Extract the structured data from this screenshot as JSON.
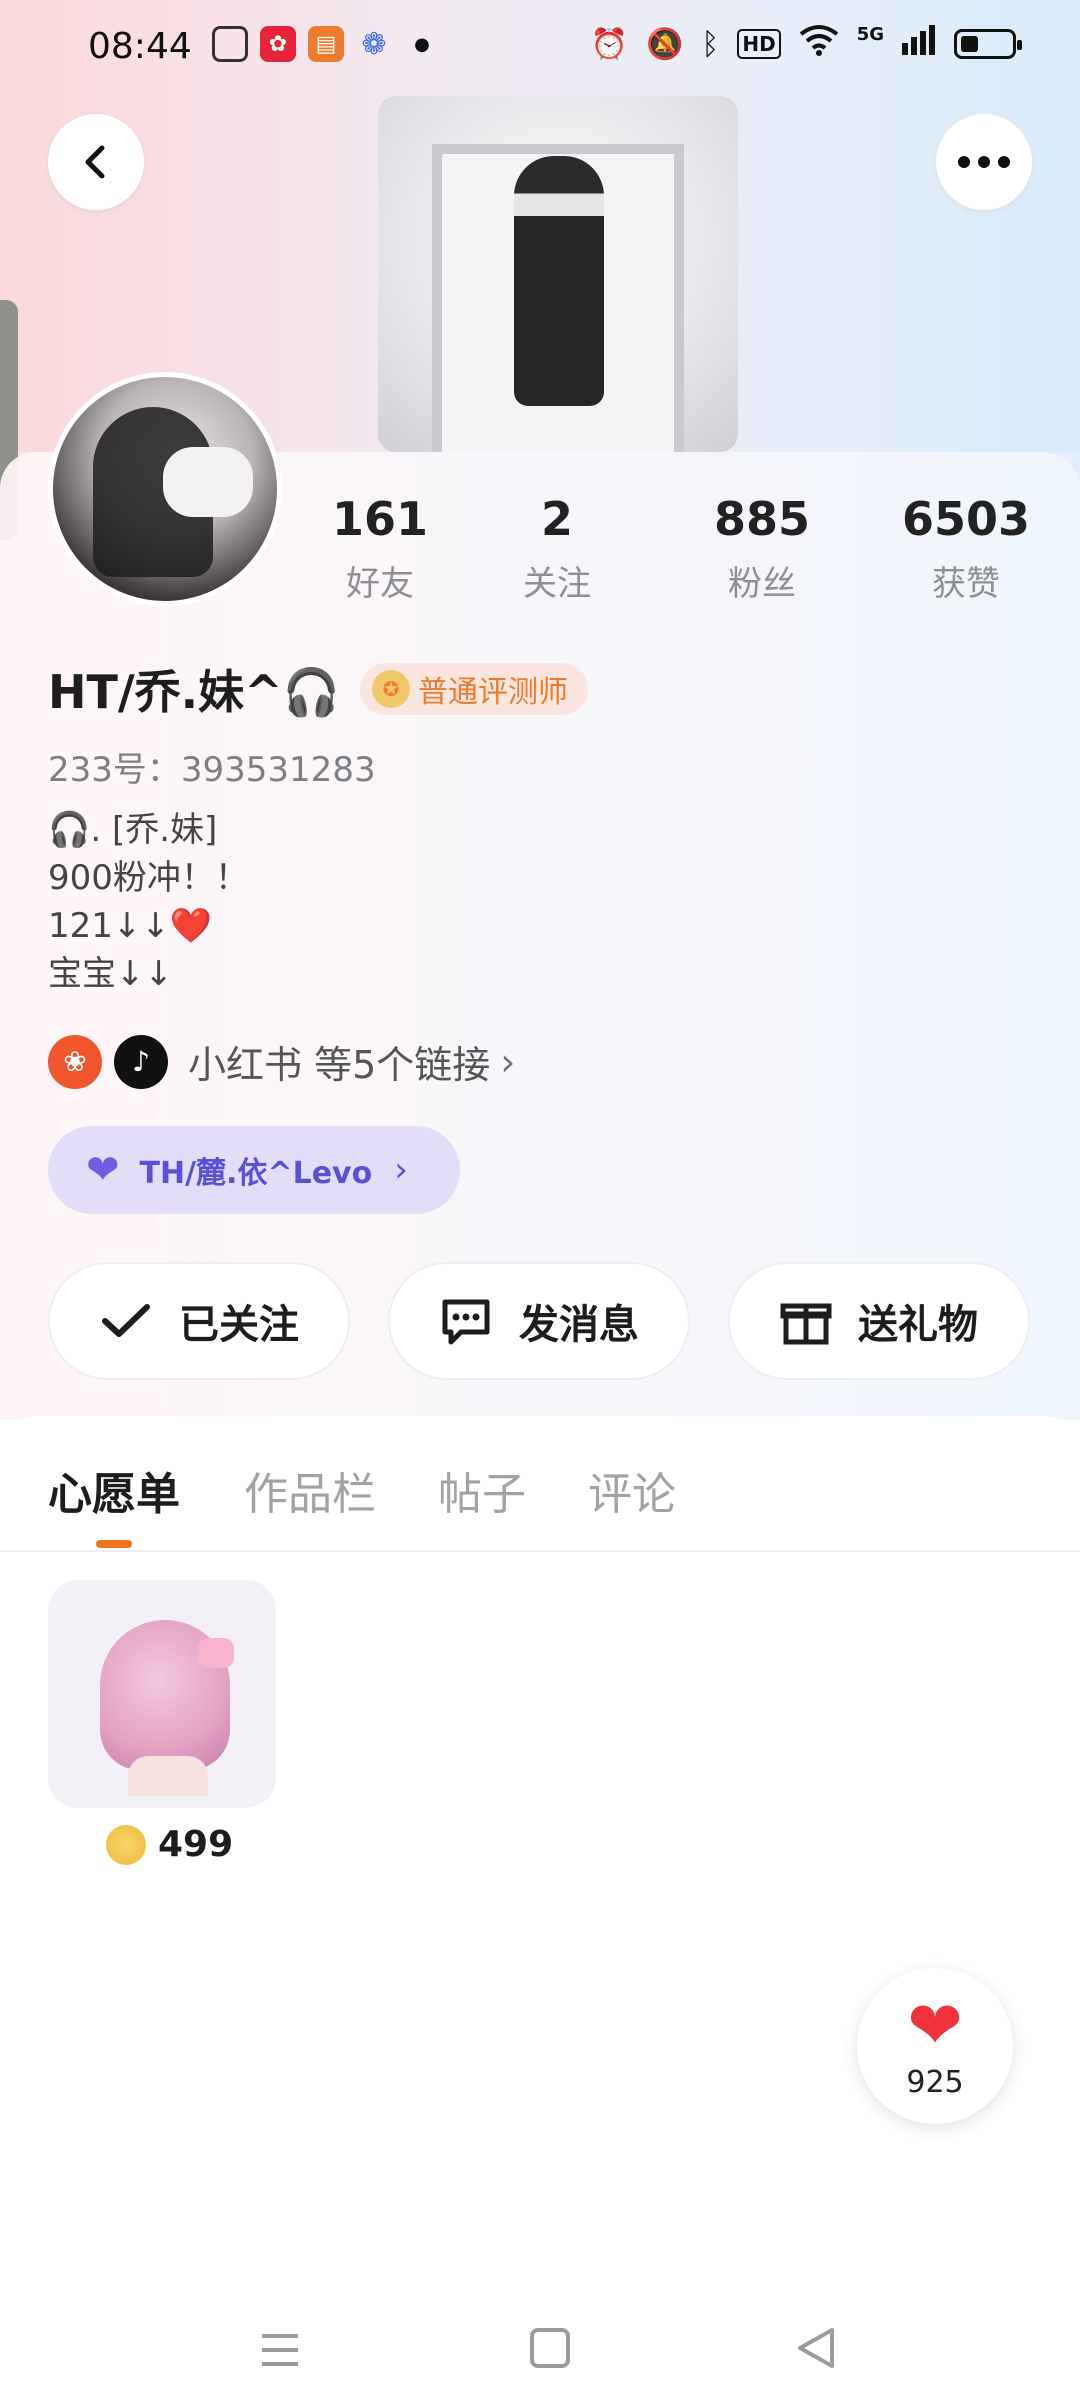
{
  "status_bar": {
    "time": "08:44",
    "network": "5G",
    "battery_level": 0.35,
    "icons": [
      "app-folder-icon",
      "app-red-icon",
      "app-book-icon",
      "app-paw-icon",
      "dot-icon",
      "alarm-icon",
      "mute-icon",
      "bluetooth-icon",
      "hd-icon",
      "wifi-icon",
      "signal-icon",
      "battery-icon"
    ]
  },
  "header": {
    "back_icon": "back-icon",
    "more_icon": "more-icon"
  },
  "profile": {
    "name": "HT/乔.妹^🎧",
    "badge_label": "普通评测师",
    "uid": "233号：393531283",
    "bio": [
      "🎧. [乔.妹]",
      "900粉冲！！",
      "121↓↓❤️",
      "宝宝↓↓"
    ]
  },
  "stats": [
    {
      "num": "161",
      "label": "好友"
    },
    {
      "num": "2",
      "label": "关注"
    },
    {
      "num": "885",
      "label": "粉丝"
    },
    {
      "num": "6503",
      "label": "获赞"
    }
  ],
  "links": {
    "text": "小红书 等5个链接",
    "chevron": "›"
  },
  "cp_pill": {
    "label": "TH/麓.依^Levo",
    "arrow": "›",
    "color": "#5b4fd6"
  },
  "actions": {
    "follow_label": "已关注",
    "message_label": "发消息",
    "gift_label": "送礼物"
  },
  "tabs": [
    "心愿单",
    "作品栏",
    "帖子",
    "评论"
  ],
  "active_tab": 0,
  "wishlist": [
    {
      "price": "499"
    }
  ],
  "like_count": "925",
  "colors": {
    "accent": "#f0741f",
    "badge_text": "#f07a2c",
    "heart": "#f0323c"
  }
}
